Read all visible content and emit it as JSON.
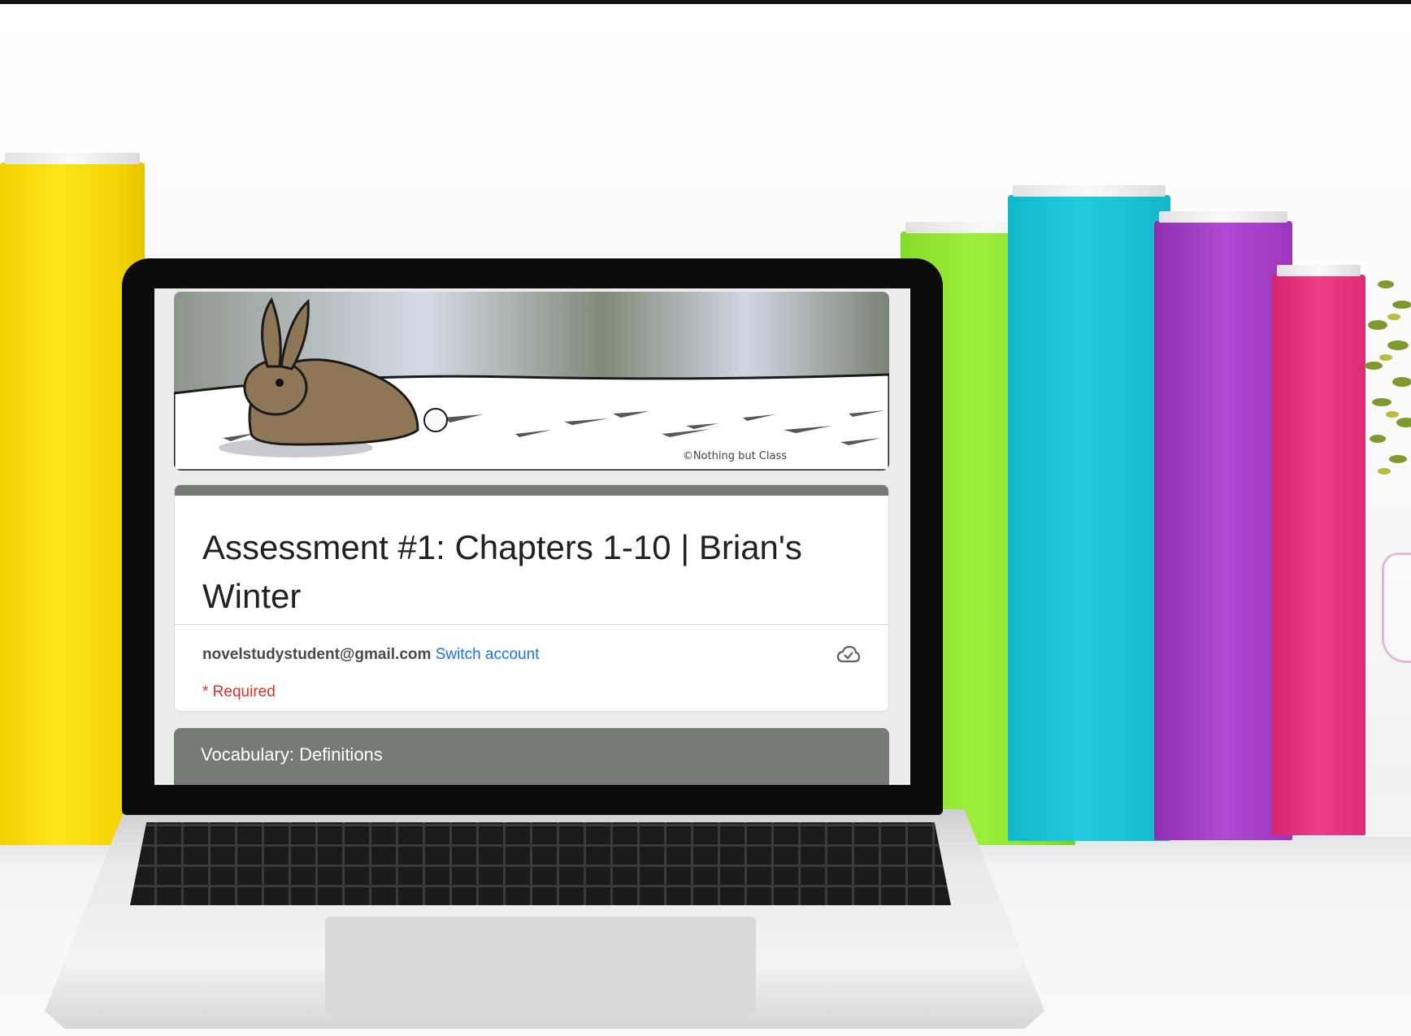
{
  "banner": {
    "image_name": "snowshoe-rabbit-banner",
    "credit": "©Nothing but Class"
  },
  "form": {
    "title": "Assessment #1: Chapters 1-10 | Brian's Winter",
    "account_email": "novelstudystudent@gmail.com",
    "switch_account_label": "Switch account",
    "required_note": "* Required",
    "saved_icon": "cloud-check-icon"
  },
  "section": {
    "title": "Vocabulary: Definitions"
  },
  "colors": {
    "accent": "#757b74",
    "link": "#1a73e8",
    "required": "#d93025"
  }
}
